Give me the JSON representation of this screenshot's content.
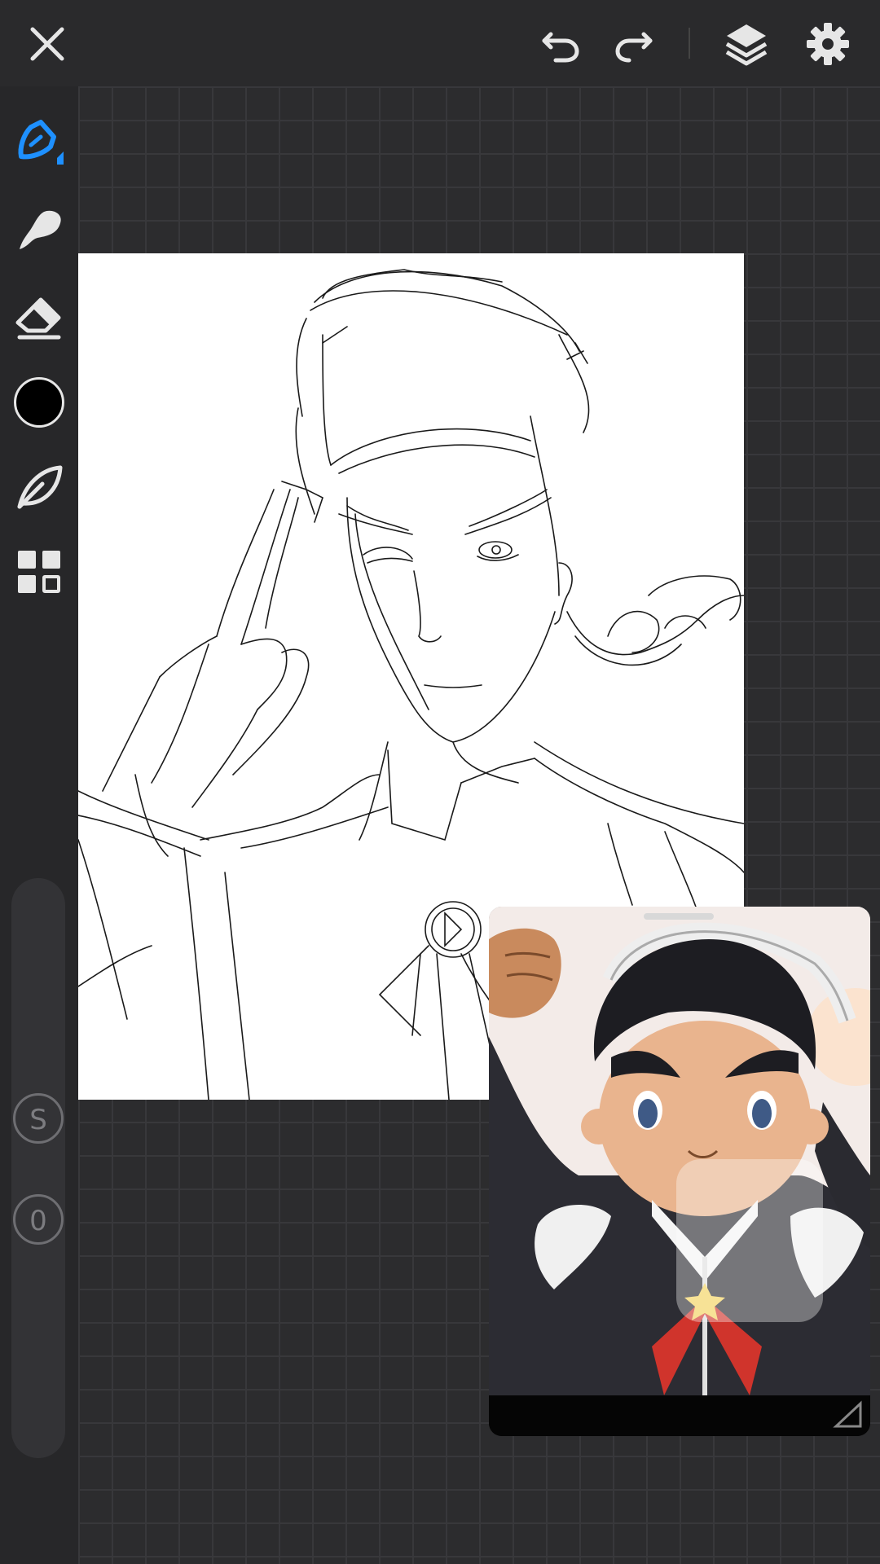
{
  "app": {
    "accent_color": "#1e90ff",
    "toolbar_bg": "#2a2a2c",
    "canvas_bg": "#2c2c2e"
  },
  "topbar": {
    "icons": [
      "close-icon",
      "undo-icon",
      "redo-icon",
      "layers-icon",
      "settings-icon"
    ]
  },
  "sidebar": {
    "tools": [
      "pen-tool",
      "smudge-tool",
      "eraser-tool",
      "color-swatch",
      "leaf-tool",
      "panels-tool"
    ],
    "active_tool": "pen-tool",
    "current_color": "#000000",
    "stabilizer_label": "S",
    "opacity_label": "0"
  },
  "reference": {
    "icons": [
      "play-icon",
      "resize-handle-icon"
    ]
  }
}
